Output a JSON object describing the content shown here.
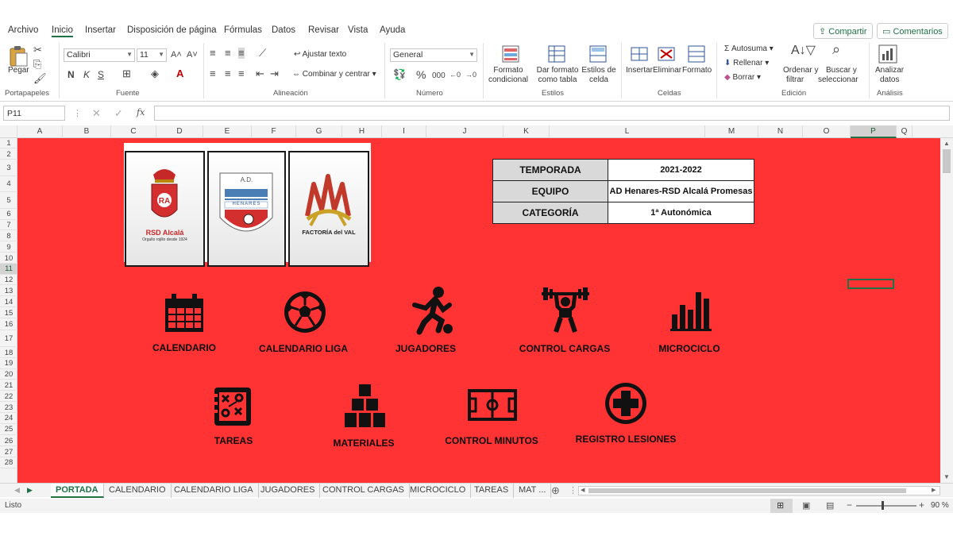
{
  "menu": {
    "items": [
      "Archivo",
      "Inicio",
      "Insertar",
      "Disposición de página",
      "Fórmulas",
      "Datos",
      "Revisar",
      "Vista",
      "Ayuda"
    ],
    "share_label": "Compartir",
    "comments_label": "Comentarios"
  },
  "ribbon": {
    "portapapeles": {
      "paste_label": "Pegar",
      "group": "Portapapeles"
    },
    "fuente": {
      "font": "Calibri",
      "size": "11",
      "group": "Fuente",
      "bold": "N",
      "italic": "K",
      "underline": "S"
    },
    "alineacion": {
      "wrap": "Ajustar texto",
      "merge": "Combinar y centrar",
      "group": "Alineación"
    },
    "numero": {
      "format": "General",
      "group": "Número"
    },
    "estilos": {
      "cond_1": "Formato",
      "cond_2": "condicional",
      "table_1": "Dar formato",
      "table_2": "como tabla",
      "cell_1": "Estilos de",
      "cell_2": "celda",
      "group": "Estilos"
    },
    "celdas": {
      "insert": "Insertar",
      "delete": "Eliminar",
      "format": "Formato",
      "group": "Celdas"
    },
    "edicion": {
      "autosum": "Autosuma",
      "fill": "Rellenar",
      "clear": "Borrar",
      "sort_1": "Ordenar y",
      "sort_2": "filtrar",
      "find_1": "Buscar y",
      "find_2": "seleccionar",
      "group": "Edición"
    },
    "analisis": {
      "analyze_1": "Analizar",
      "analyze_2": "datos",
      "group": "Análisis"
    }
  },
  "formula_bar": {
    "name_box": "P11",
    "fx": "fx",
    "content": ""
  },
  "columns": [
    "A",
    "B",
    "C",
    "D",
    "E",
    "F",
    "G",
    "H",
    "I",
    "J",
    "K",
    "L",
    "M",
    "N",
    "O",
    "P",
    "Q"
  ],
  "selected_column": "P",
  "rows": [
    "1",
    "2",
    "3",
    "4",
    "5",
    "6",
    "7",
    "8",
    "9",
    "10",
    "11",
    "12",
    "13",
    "14",
    "15",
    "16",
    "17",
    "18",
    "19",
    "20",
    "21",
    "22",
    "23",
    "24",
    "25",
    "26",
    "27",
    "28"
  ],
  "selected_row": "11",
  "logos": {
    "rsd_name": "RSD Alcalá",
    "rsd_motto": "Orgullo rojillo desde 1924",
    "ad_top": "A.D.",
    "ad_name": "HENARES",
    "factoria": "FACTORÍA del VAL"
  },
  "info": {
    "season_key": "TEMPORADA",
    "season_val": "2021-2022",
    "team_key": "EQUIPO",
    "team_val": "AD Henares-RSD Alcalá Promesas",
    "cat_key": "CATEGORÍA",
    "cat_val": "1ª Autonómica"
  },
  "tiles": {
    "calendario": "CALENDARIO",
    "calendario_liga": "CALENDARIO LIGA",
    "jugadores": "JUGADORES",
    "control_cargas": "CONTROL CARGAS",
    "microciclo": "MICROCICLO",
    "tareas": "TAREAS",
    "materiales": "MATERIALES",
    "control_minutos": "CONTROL MINUTOS",
    "registro_lesiones": "REGISTRO LESIONES"
  },
  "sheet_tabs": [
    "PORTADA",
    "CALENDARIO",
    "CALENDARIO LIGA",
    "JUGADORES",
    "CONTROL CARGAS",
    "MICROCICLO",
    "TAREAS",
    "MAT ..."
  ],
  "status": {
    "ready": "Listo",
    "zoom": "90 %"
  },
  "colors": {
    "sheet_bg": "#ff3333",
    "accent": "#217346"
  }
}
